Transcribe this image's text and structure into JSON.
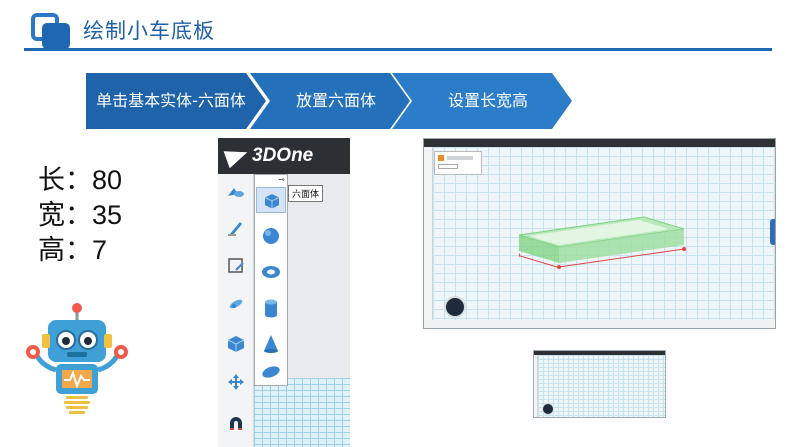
{
  "header": {
    "title": "绘制小车底板"
  },
  "steps": [
    {
      "label": "单击基本实体-六面体"
    },
    {
      "label": "放置六面体"
    },
    {
      "label": "设置长宽高"
    }
  ],
  "dimensions": [
    {
      "label": "长",
      "value": "80"
    },
    {
      "label": "宽",
      "value": "35"
    },
    {
      "label": "高",
      "value": "7"
    }
  ],
  "toolbar": {
    "logo": "3DOne",
    "tooltip": "六面体",
    "tools": [
      "basic-solid-icon",
      "sketch-icon",
      "edit-sketch-icon",
      "feature-icon",
      "combine-icon",
      "move-icon",
      "magnet-icon"
    ],
    "flyout_items": [
      "box-icon",
      "sphere-icon",
      "torus-icon",
      "cylinder-icon",
      "cone-icon",
      "ellipsoid-icon"
    ]
  },
  "colors": {
    "brand_blue": "#1f66b3",
    "step1": "#1f63aa",
    "step2": "#2470bb",
    "step3": "#2b7dc9",
    "box_green": "#86d98a"
  }
}
